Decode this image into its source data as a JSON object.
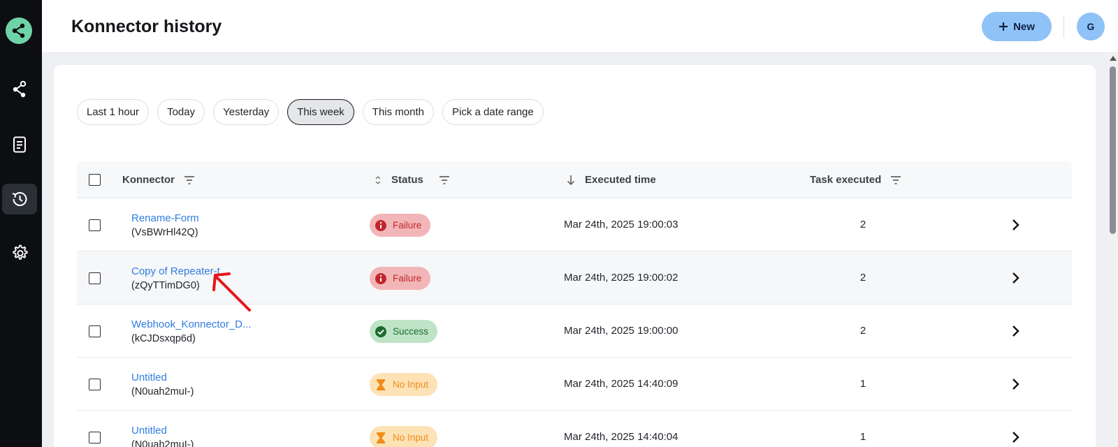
{
  "header": {
    "title": "Konnector history",
    "new_button_label": "New",
    "avatar_initial": "G"
  },
  "sidebar": {
    "items": [
      {
        "name": "konnectors",
        "icon": "share-nodes-icon"
      },
      {
        "name": "documents",
        "icon": "document-icon"
      },
      {
        "name": "history",
        "icon": "history-icon",
        "active": true
      },
      {
        "name": "settings",
        "icon": "gear-icon"
      }
    ]
  },
  "filters": {
    "chips": [
      "Last 1 hour",
      "Today",
      "Yesterday",
      "This week",
      "This month",
      "Pick a date range"
    ],
    "selected": "This week"
  },
  "table": {
    "columns": {
      "konnector": "Konnector",
      "status": "Status",
      "executed_time": "Executed time",
      "task_executed": "Task executed"
    },
    "rows": [
      {
        "name": "Rename-Form",
        "id": "(VsBWrHl42Q)",
        "status": "Failure",
        "status_type": "failure",
        "time": "Mar 24th, 2025 19:00:03",
        "tasks": "2"
      },
      {
        "name": "Copy of Repeater-t...",
        "id": "(zQyTTimDG0)",
        "status": "Failure",
        "status_type": "failure",
        "time": "Mar 24th, 2025 19:00:02",
        "tasks": "2"
      },
      {
        "name": "Webhook_Konnector_D...",
        "id": "(kCJDsxqp6d)",
        "status": "Success",
        "status_type": "success",
        "time": "Mar 24th, 2025 19:00:00",
        "tasks": "2"
      },
      {
        "name": "Untitled",
        "id": "(N0uah2muI-)",
        "status": "No Input",
        "status_type": "noinput",
        "time": "Mar 24th, 2025 14:40:09",
        "tasks": "1"
      },
      {
        "name": "Untitled",
        "id": "(N0uah2muI-)",
        "status": "No Input",
        "status_type": "noinput",
        "time": "Mar 24th, 2025 14:40:04",
        "tasks": "1"
      }
    ]
  },
  "colors": {
    "sidebar_bg": "#0c0e12",
    "accent": "#8fc2f7",
    "link": "#2f7de1",
    "failure": "#c0272d",
    "success": "#1a6b2e",
    "noinput": "#f08c1a",
    "annotation_arrow": "#e8141a"
  }
}
